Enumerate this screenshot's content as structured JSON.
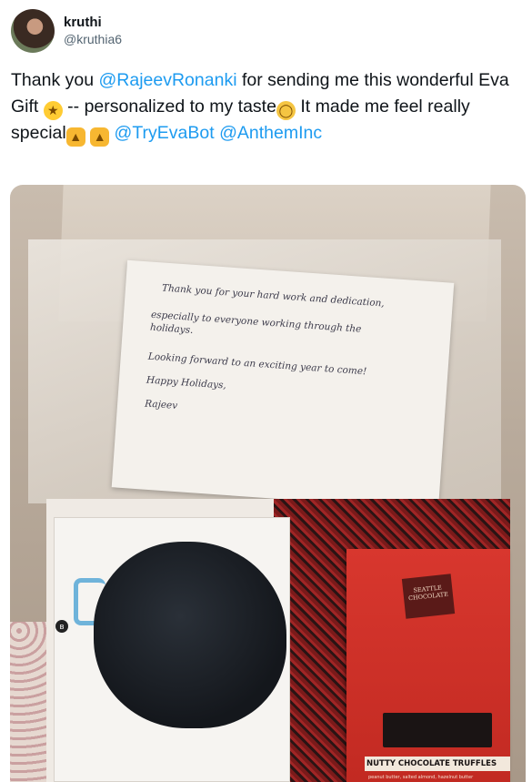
{
  "author": {
    "display_name": "kruthi",
    "handle": "@kruthia6"
  },
  "tweet": {
    "part1": "Thank you ",
    "mention1": "@RajeevRonanki",
    "part2": "  for sending me this wonderful Eva Gift ",
    "part3": " -- personalized to my taste",
    "part4": " It made me feel really special",
    "mention2": "@TryEvaBot",
    "mention3": "@AnthemInc"
  },
  "emojis": [
    "star-struck",
    "ok-hand",
    "thumbs-up",
    "thumbs-up"
  ],
  "photo": {
    "note_lines": [
      "Thank you for your hard work and dedication,",
      "especially to everyone working through the",
      "holidays.",
      "Looking forward to an exciting year to come!",
      "Happy Holidays,",
      "Rajeev"
    ],
    "badge": [
      "SEATTLE",
      "CHOCOLATE"
    ],
    "product_name": "NUTTY CHOCOLATE TRUFFLES",
    "product_sub": "peanut butter, salted almond, hazelnut butter"
  },
  "colors": {
    "link": "#1d9bf0",
    "text": "#0f1419",
    "secondary": "#536471"
  }
}
